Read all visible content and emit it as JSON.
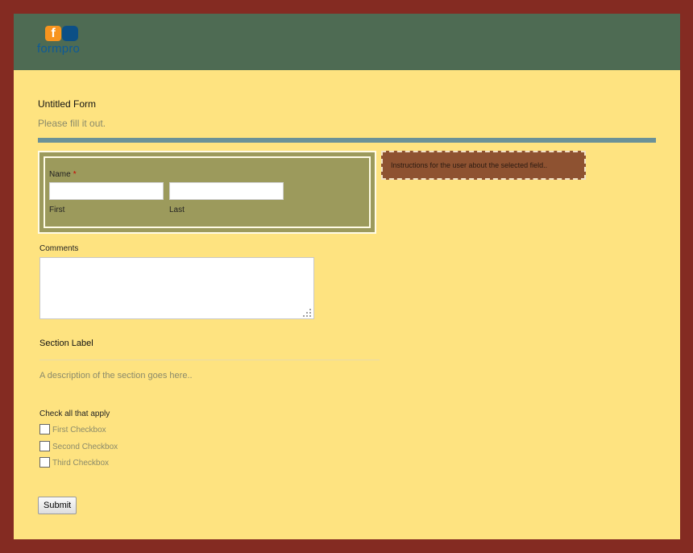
{
  "brand": {
    "logo_letter": "f",
    "logo_text": "formpro"
  },
  "form": {
    "title": "Untitled Form",
    "description": "Please fill it out."
  },
  "name_field": {
    "label": "Name",
    "required_mark": "*",
    "first_label": "First",
    "last_label": "Last",
    "first_value": "",
    "last_value": ""
  },
  "tooltip": {
    "text": "Instructions for the user about the selected field.."
  },
  "comments": {
    "label": "Comments",
    "value": ""
  },
  "section": {
    "label": "Section Label",
    "description": "A description of the section goes here.."
  },
  "checkboxes": {
    "title": "Check all that apply",
    "items": [
      {
        "label": "First Checkbox",
        "checked": false
      },
      {
        "label": "Second Checkbox",
        "checked": false
      },
      {
        "label": "Third Checkbox",
        "checked": false
      }
    ]
  },
  "submit": {
    "label": "Submit"
  },
  "colors": {
    "outer_border": "#842b22",
    "header": "#4e6b53",
    "page_bg": "#fee380",
    "divider": "#6b9197",
    "selected_field": "#9c9a5c",
    "tooltip": "#8e5231",
    "logo_orange": "#f7941e",
    "logo_blue": "#0c4f86"
  }
}
